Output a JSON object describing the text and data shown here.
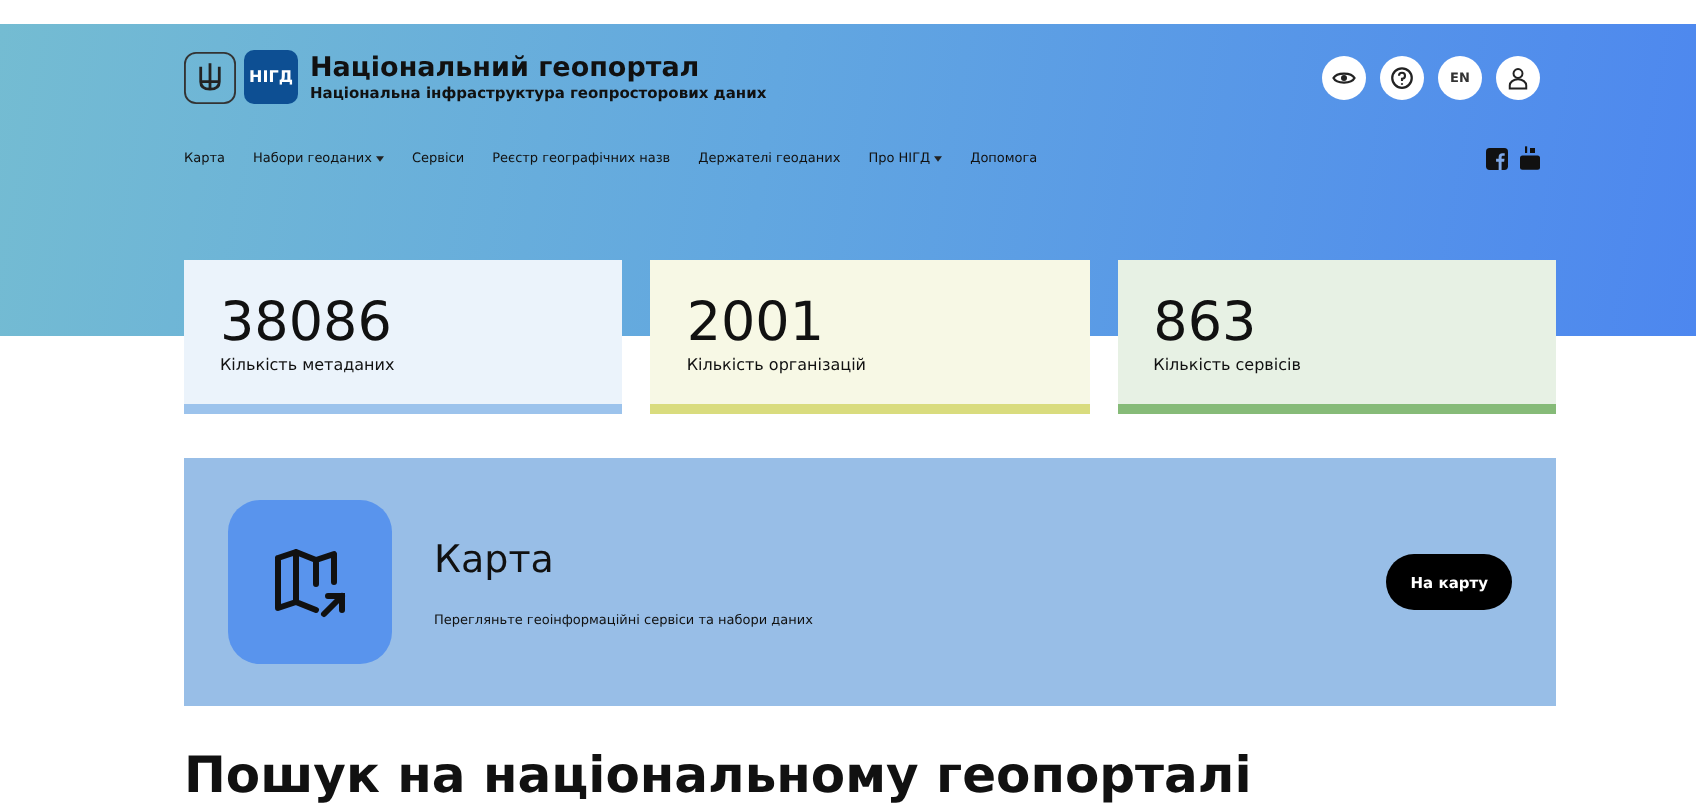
{
  "brand": {
    "badge": "НІГД",
    "title": "Національний геопортал",
    "subtitle": "Національна інфраструктура геопросторових даних"
  },
  "top_buttons": [
    {
      "kind": "eye"
    },
    {
      "kind": "help"
    },
    {
      "kind": "text",
      "label": "EN"
    },
    {
      "kind": "user"
    }
  ],
  "nav": [
    {
      "label": "Карта",
      "dropdown": false
    },
    {
      "label": "Набори геоданих",
      "dropdown": true
    },
    {
      "label": "Сервіси",
      "dropdown": false
    },
    {
      "label": "Реєстр географічних назв",
      "dropdown": false
    },
    {
      "label": "Держателі геоданих",
      "dropdown": false
    },
    {
      "label": "Про НІГД",
      "dropdown": true
    },
    {
      "label": "Допомога",
      "dropdown": false
    }
  ],
  "stats": [
    {
      "value": "38086",
      "label": "Кількість метаданих",
      "color": "#9cc3ec"
    },
    {
      "value": "2001",
      "label": "Кількість організацій",
      "color": "#d9dc7e"
    },
    {
      "value": "863",
      "label": "Кількість сервісів",
      "color": "#86bb78"
    }
  ],
  "map_card": {
    "title": "Карта",
    "description": "Перегляньте геоінформаційні сервіси та набори даних",
    "button": "На карту"
  },
  "search_heading": "Пошук на національному геопорталі"
}
